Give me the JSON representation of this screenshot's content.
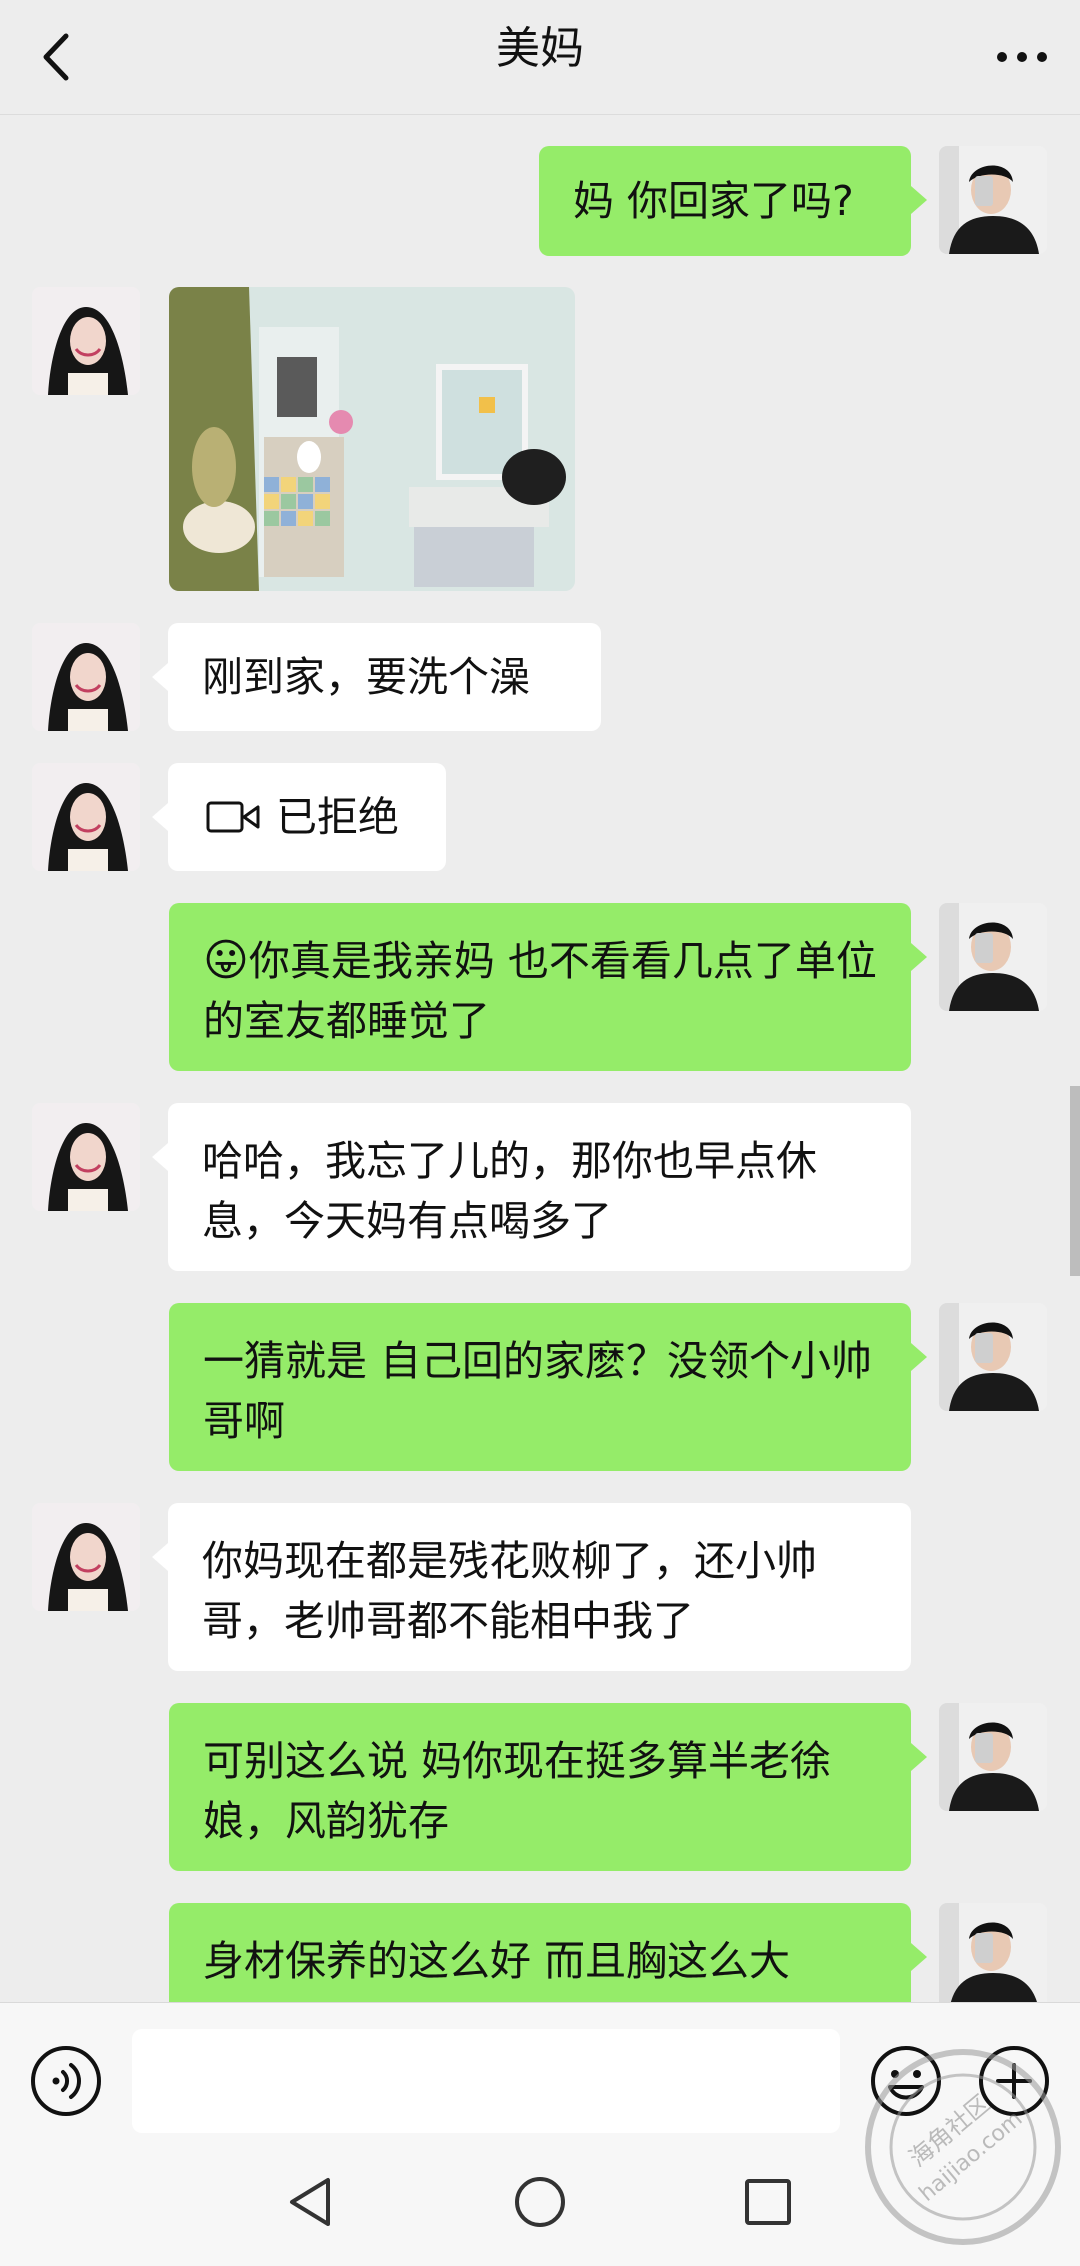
{
  "header": {
    "title": "美妈"
  },
  "messages": [
    {
      "side": "out",
      "text": "妈 你回家了吗?"
    },
    {
      "side": "in",
      "type": "image",
      "alt": "bathroom-photo"
    },
    {
      "side": "in",
      "text": "刚到家，要洗个澡"
    },
    {
      "side": "in",
      "type": "call",
      "text": "已拒绝"
    },
    {
      "side": "out",
      "emoji": "😛",
      "text": "你真是我亲妈 也不看看几点了单位的室友都睡觉了"
    },
    {
      "side": "in",
      "text": "哈哈，我忘了儿的，那你也早点休息，今天妈有点喝多了"
    },
    {
      "side": "out",
      "text": "一猜就是 自己回的家麽？没领个小帅哥啊"
    },
    {
      "side": "in",
      "text": "你妈现在都是残花败柳了，还小帅哥，老帅哥都不能相中我了"
    },
    {
      "side": "out",
      "text": "可别这么说 妈你现在挺多算半老徐娘，风韵犹存"
    },
    {
      "side": "out",
      "text": "身材保养的这么好 而且胸这么大"
    }
  ],
  "input": {
    "placeholder": ""
  },
  "icons": [
    "back-icon",
    "more-icon",
    "voice-icon",
    "emoji-icon",
    "plus-icon",
    "video-call-icon",
    "nav-back-icon",
    "nav-home-icon",
    "nav-recent-icon"
  ],
  "watermark": {
    "line1": "海角社区",
    "line2": "haijiao.com"
  },
  "colors": {
    "background": "#ededed",
    "out_bubble": "#95ec69",
    "in_bubble": "#ffffff"
  }
}
